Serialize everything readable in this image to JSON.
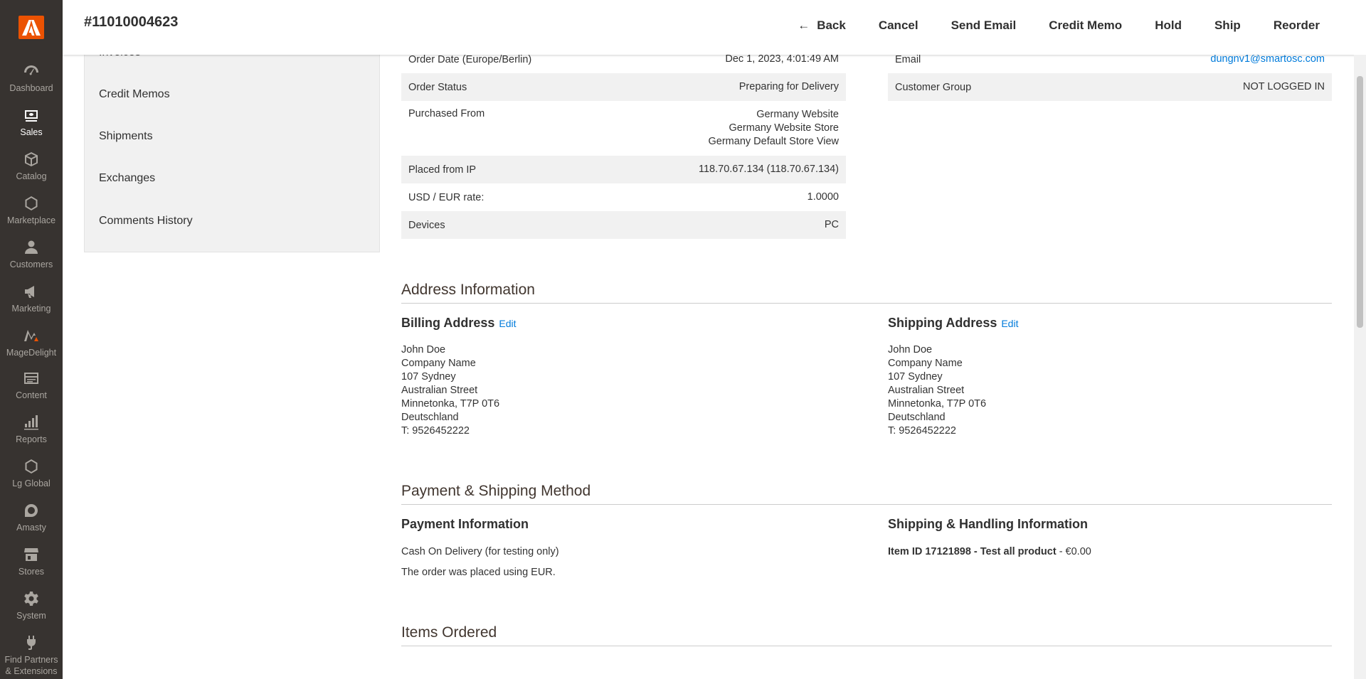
{
  "nav": {
    "items": [
      {
        "label": "Dashboard",
        "icon": "dashboard-icon"
      },
      {
        "label": "Sales",
        "icon": "sales-icon",
        "active": true
      },
      {
        "label": "Catalog",
        "icon": "catalog-icon"
      },
      {
        "label": "Marketplace",
        "icon": "marketplace-icon"
      },
      {
        "label": "Customers",
        "icon": "customers-icon"
      },
      {
        "label": "Marketing",
        "icon": "marketing-icon"
      },
      {
        "label": "MageDelight",
        "icon": "magedelight-icon"
      },
      {
        "label": "Content",
        "icon": "content-icon"
      },
      {
        "label": "Reports",
        "icon": "reports-icon"
      },
      {
        "label": "Lg Global",
        "icon": "lg-global-icon"
      },
      {
        "label": "Amasty",
        "icon": "amasty-icon"
      },
      {
        "label": "Stores",
        "icon": "stores-icon"
      },
      {
        "label": "System",
        "icon": "system-icon"
      },
      {
        "label_1": "Find Partners",
        "label_2": "& Extensions",
        "icon": "extensions-icon"
      }
    ]
  },
  "header": {
    "title": "#11010004623",
    "actions": {
      "back": "Back",
      "cancel": "Cancel",
      "send_email": "Send Email",
      "credit_memo": "Credit Memo",
      "hold": "Hold",
      "ship": "Ship",
      "reorder": "Reorder"
    }
  },
  "tabs": {
    "invoices": "Invoices",
    "credit_memos": "Credit Memos",
    "shipments": "Shipments",
    "exchanges": "Exchanges",
    "comments_history": "Comments History"
  },
  "order_info": {
    "order_date_label": "Order Date (Europe/Berlin)",
    "order_date_value": "Dec 1, 2023, 4:01:49 AM",
    "status_label": "Order Status",
    "status_value": "Preparing for Delivery",
    "purchased_label": "Purchased From",
    "purchased_1": "Germany Website",
    "purchased_2": "Germany Website Store",
    "purchased_3": "Germany Default Store View",
    "ip_label": "Placed from IP",
    "ip_value": "118.70.67.134 (118.70.67.134)",
    "rate_label": "USD / EUR rate:",
    "rate_value": "1.0000",
    "devices_label": "Devices",
    "devices_value": "PC"
  },
  "account_info": {
    "email_label": "Email",
    "email_value": "dungnv1@smartosc.com",
    "group_label": "Customer Group",
    "group_value": "NOT LOGGED IN"
  },
  "address_section": {
    "title": "Address Information",
    "edit_label": "Edit",
    "billing": {
      "heading": "Billing Address",
      "lines": [
        "John Doe",
        "Company Name",
        "107 Sydney",
        "Australian Street",
        "Minnetonka, T7P 0T6",
        "Deutschland",
        "T: 9526452222"
      ]
    },
    "shipping": {
      "heading": "Shipping Address",
      "lines": [
        "John Doe",
        "Company Name",
        "107 Sydney",
        "Australian Street",
        "Minnetonka, T7P 0T6",
        "Deutschland",
        "T: 9526452222"
      ]
    }
  },
  "payment_section": {
    "title": "Payment & Shipping Method",
    "payment_heading": "Payment Information",
    "payment_method": "Cash On Delivery (for testing only)",
    "payment_note": "The order was placed using EUR.",
    "shipping_heading": "Shipping & Handling Information",
    "shipping_item": "Item ID 17121898 - Test all product",
    "shipping_price": "- €0.00"
  },
  "items_section": {
    "title": "Items Ordered"
  },
  "colors": {
    "nav_bg": "#373330",
    "logo": "#eb5202",
    "link": "#007bdb"
  }
}
